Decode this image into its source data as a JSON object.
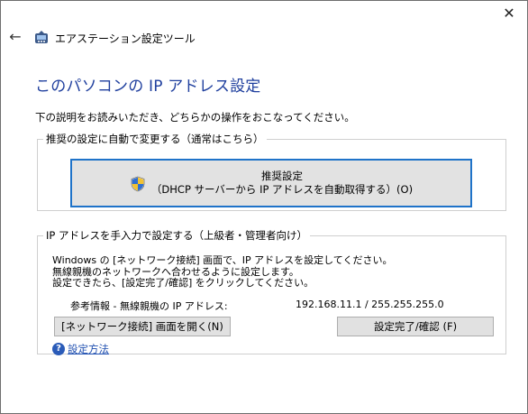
{
  "window": {
    "close_glyph": "✕"
  },
  "header": {
    "back_glyph": "←",
    "title": "エアステーション設定ツール"
  },
  "page": {
    "title": "このパソコンの IP アドレス設定",
    "instruction": "下の説明をお読みいただき、どちらかの操作をおこなってください。"
  },
  "auto_group": {
    "legend": "推奨の設定に自動で変更する（通常はこちら）",
    "recommended_button": {
      "line1": "推奨設定",
      "line2": "（DHCP サーバーから IP アドレスを自動取得する）(O)"
    }
  },
  "manual_group": {
    "legend": "IP アドレスを手入力で設定する（上級者・管理者向け）",
    "desc_lines": [
      "Windows の [ネットワーク接続] 画面で、IP アドレスを設定してください。",
      "無線親機のネットワークへ合わせるように設定します。",
      "設定できたら、[設定完了/確認] をクリックしてください。"
    ],
    "ref_label": "参考情報 - 無線親機の IP アドレス:",
    "ref_value": "192.168.11.1 / 255.255.255.0",
    "open_network_button": "[ネットワーク接続] 画面を開く(N)",
    "done_button": "設定完了/確認 (F)",
    "help_link": "設定方法"
  },
  "icons": {
    "app": "router-tool-icon",
    "shield": "uac-shield-icon",
    "help": "help-icon",
    "help_glyph": "?"
  },
  "colors": {
    "title_blue": "#1f3f9e",
    "focus_border": "#1f73c9",
    "link_blue": "#1f4fb0"
  }
}
